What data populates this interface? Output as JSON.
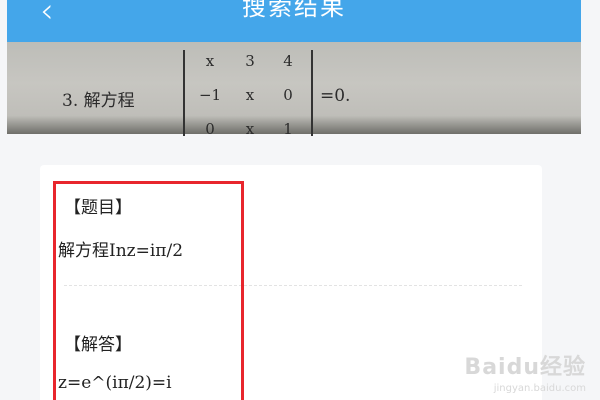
{
  "header": {
    "title": "搜索结果",
    "back_icon": "‹"
  },
  "photo": {
    "question_prefix": "3. 解方程",
    "matrix": [
      [
        "x",
        "3",
        "4"
      ],
      [
        "−1",
        "x",
        "0"
      ],
      [
        "0",
        "x",
        "1"
      ]
    ],
    "equals": "=0."
  },
  "card": {
    "question_label": "【题目】",
    "question_text": "解方程Inz=iπ/2",
    "answer_label": "【解答】",
    "answer_text": "z=e^(iπ/2)=i"
  },
  "watermark": {
    "main": "Baidu经验",
    "sub": "jingyan.baidu.com"
  },
  "colors": {
    "header": "#44a6ea",
    "highlight": "#e8262d",
    "card": "#ffffff",
    "background": "#f5f6f8"
  }
}
